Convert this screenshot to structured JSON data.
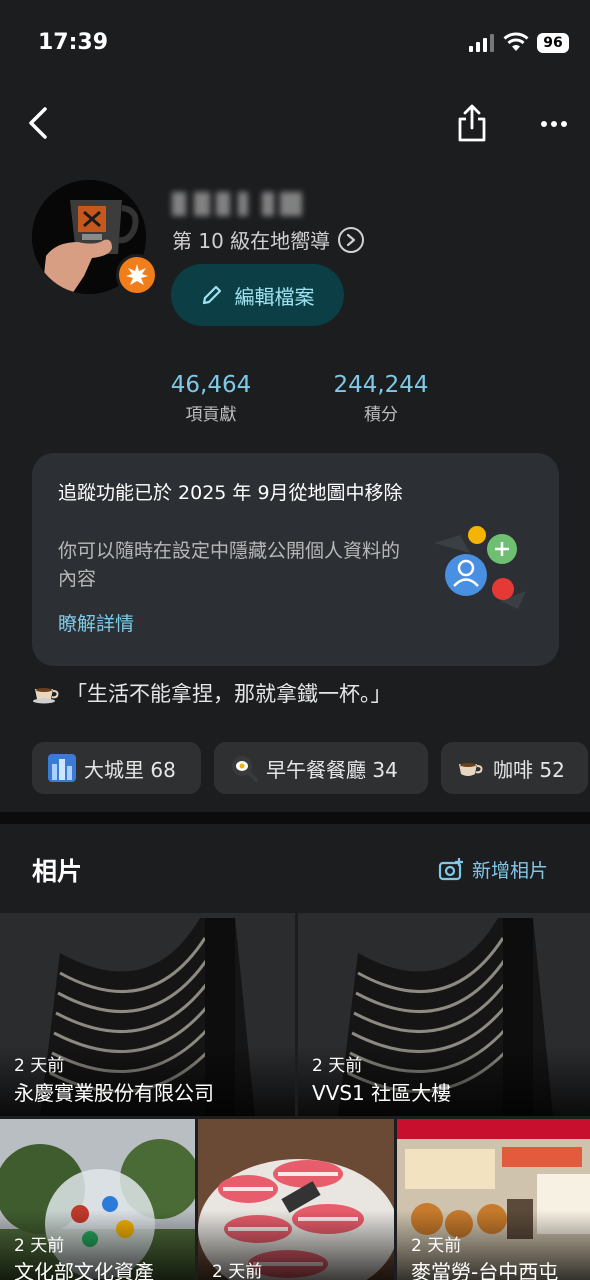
{
  "status": {
    "time": "17:39",
    "battery": "96"
  },
  "profile": {
    "level_text": "第 10 級在地嚮導",
    "edit_label": "編輯檔案"
  },
  "stats": [
    {
      "value": "46,464",
      "label": "項貢獻"
    },
    {
      "value": "244,244",
      "label": "積分"
    }
  ],
  "notice": {
    "title": "追蹤功能已於 2025 年 9月從地圖中移除",
    "desc": "你可以隨時在設定中隱藏公開個人資料的內容",
    "link": "瞭解詳情"
  },
  "quote": "「生活不能拿捏，那就拿鐵一杯。」",
  "chips": [
    {
      "label": "大城里 68",
      "icon": "city-icon"
    },
    {
      "label": "早午餐餐廳 34",
      "icon": "frying-pan-icon"
    },
    {
      "label": "咖啡 52",
      "icon": "coffee-icon"
    }
  ],
  "photos": {
    "title": "相片",
    "add_label": "新增相片",
    "items": [
      {
        "ago": "2 天前",
        "place": "永慶實業股份有限公司"
      },
      {
        "ago": "2 天前",
        "place": "VVS1 社區大樓"
      },
      {
        "ago": "2 天前",
        "place": "文化部文化資產"
      },
      {
        "ago": "2 天前",
        "place": ""
      },
      {
        "ago": "2 天前",
        "place": "麥當勞-台中西屯"
      }
    ]
  },
  "colors": {
    "accent": "#7fc8e8",
    "badge": "#f07e1b",
    "edit_bg": "#0b3e45",
    "card": "#2c3034"
  }
}
